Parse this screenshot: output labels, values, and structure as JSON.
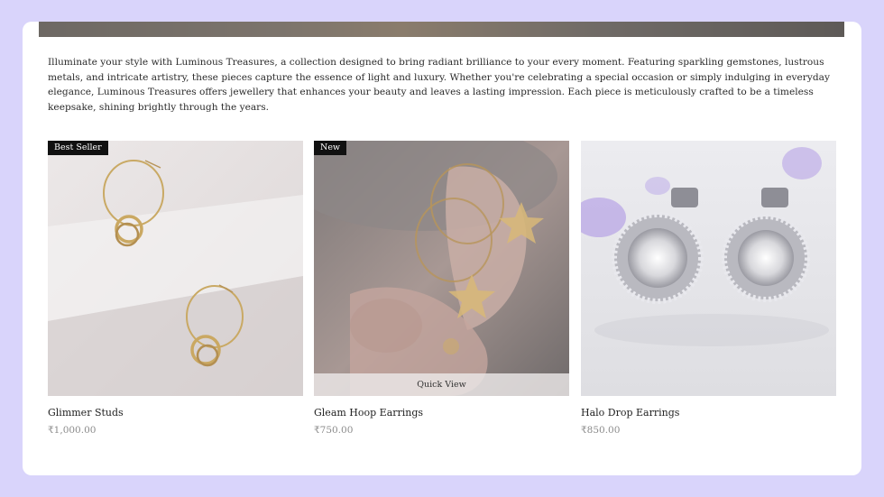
{
  "intro": {
    "text": "Illuminate your style with Luminous Treasures, a collection designed to bring radiant brilliance to your every moment. Featuring sparkling gemstones, lustrous metals, and intricate artistry, these pieces capture the essence of light and luxury. Whether you're celebrating a special occasion or simply indulging in everyday elegance, Luminous Treasures offers jewellery that enhances your beauty and leaves a lasting impression. Each piece is meticulously crafted to be a timeless keepsake, shining brightly through the years."
  },
  "products": [
    {
      "badge": "Best Seller",
      "name": "Glimmer Studs",
      "price": "₹1,000.00",
      "image": "gold-hoop-earrings-image"
    },
    {
      "badge": "New",
      "name": "Gleam Hoop Earrings",
      "price": "₹750.00",
      "quick_view": "Quick View",
      "image": "model-star-hoop-earrings-image"
    },
    {
      "name": "Halo Drop Earrings",
      "price": "₹850.00",
      "image": "diamond-halo-studs-image"
    }
  ],
  "colors": {
    "page_background": "#d9d4fb",
    "card_background": "#ffffff",
    "badge_background": "#111111",
    "price_text": "#8a8a8a"
  }
}
